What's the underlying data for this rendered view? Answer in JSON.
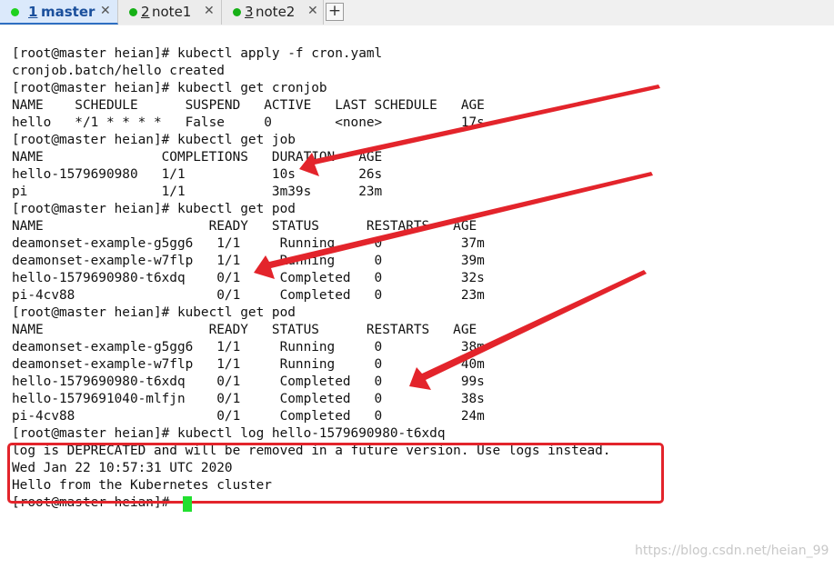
{
  "tabs": [
    {
      "number": "1",
      "name": "master",
      "close": "✕",
      "dot_color": "#1fd11f",
      "active": true
    },
    {
      "number": "2",
      "name": "note1",
      "close": "✕",
      "dot_color": "#16b016",
      "active": false
    },
    {
      "number": "3",
      "name": "note2",
      "close": "✕",
      "dot_color": "#16b016",
      "active": false
    }
  ],
  "new_tab_label": "+",
  "terminal_lines": [
    "[root@master heian]# kubectl apply -f cron.yaml",
    "cronjob.batch/hello created",
    "[root@master heian]# kubectl get cronjob",
    "NAME    SCHEDULE      SUSPEND   ACTIVE   LAST SCHEDULE   AGE",
    "hello   */1 * * * *   False     0        <none>          17s",
    "[root@master heian]# kubectl get job",
    "NAME               COMPLETIONS   DURATION   AGE",
    "hello-1579690980   1/1           10s        26s",
    "pi                 1/1           3m39s      23m",
    "[root@master heian]# kubectl get pod",
    "NAME                     READY   STATUS      RESTARTS   AGE",
    "deamonset-example-g5gg6   1/1     Running     0          37m",
    "deamonset-example-w7flp   1/1     Running     0          39m",
    "hello-1579690980-t6xdq    0/1     Completed   0          32s",
    "pi-4cv88                  0/1     Completed   0          23m",
    "[root@master heian]# kubectl get pod",
    "NAME                     READY   STATUS      RESTARTS   AGE",
    "deamonset-example-g5gg6   1/1     Running     0          38m",
    "deamonset-example-w7flp   1/1     Running     0          40m",
    "hello-1579690980-t6xdq    0/1     Completed   0          99s",
    "hello-1579691040-mlfjn    0/1     Completed   0          38s",
    "pi-4cv88                  0/1     Completed   0          24m",
    "[root@master heian]# kubectl log hello-1579690980-t6xdq",
    "log is DEPRECATED and will be removed in a future version. Use logs instead.",
    "Wed Jan 22 10:57:31 UTC 2020",
    "Hello from the Kubernetes cluster",
    "[root@master heian]# "
  ],
  "annotation_color": "#e3242b",
  "cursor_color": "#22e030",
  "watermark": "https://blog.csdn.net/heian_99"
}
